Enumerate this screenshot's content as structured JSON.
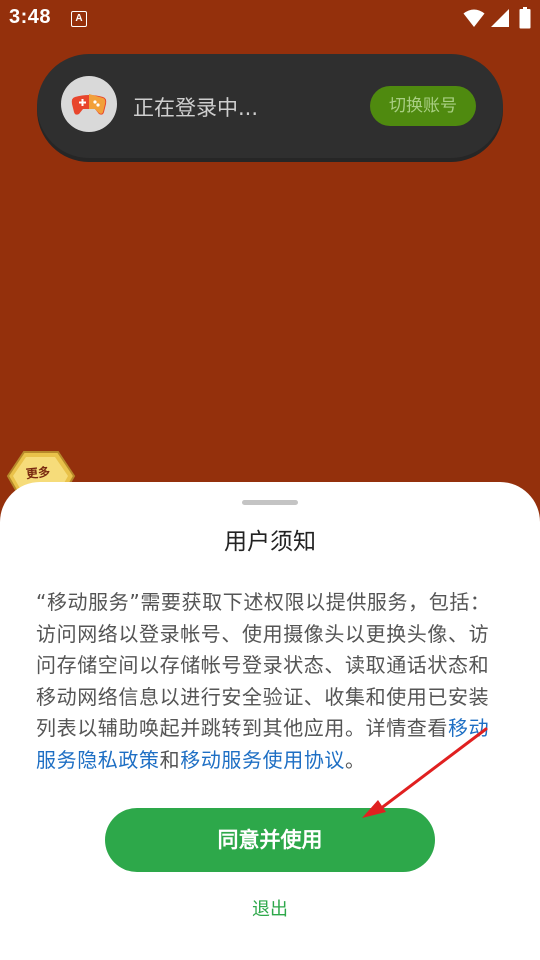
{
  "status_bar": {
    "time": "3:48",
    "app_icon_letter": "A"
  },
  "login_toast": {
    "text": "正在登录中...",
    "switch_account_label": "切换账号"
  },
  "more_badge": {
    "label": "更多"
  },
  "sheet": {
    "title": "用户须知",
    "body_prefix": "“移动服务”需要获取下述权限以提供服务，包括：访问网络以登录帐号、使用摄像头以更换头像、访问存储空间以存储帐号登录状态、读取通话状态和移动网络信息以进行安全验证、收集和使用已安装列表以辅助唤起并跳转到其他应用。详情查看",
    "privacy_link": "移动服务隐私政策",
    "conjunction": "和",
    "terms_link": "移动服务使用协议",
    "body_suffix": "。",
    "agree_button": "同意并使用",
    "exit_button": "退出"
  },
  "colors": {
    "background": "#94300c",
    "accent_green": "#2da84a",
    "link_blue": "#1e6fc4",
    "annotation_red": "#e02020"
  }
}
